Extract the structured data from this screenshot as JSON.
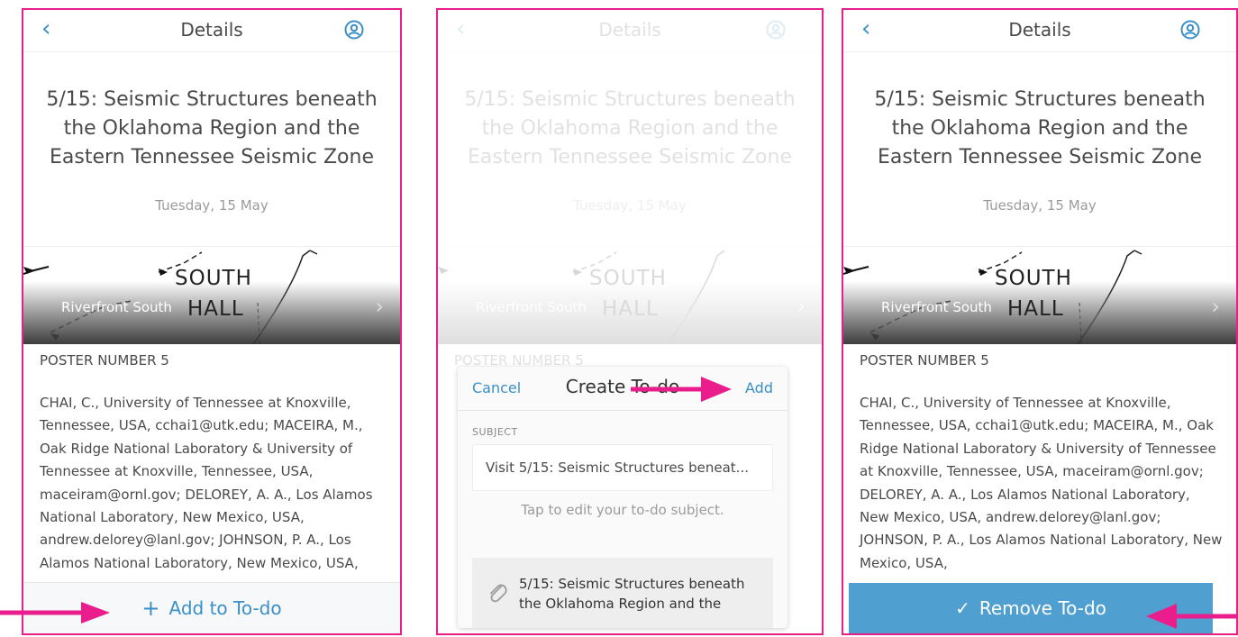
{
  "screens": [
    {
      "back_icon": "chevron-left-icon",
      "header_title": "Details",
      "profile_icon": "user-circle-icon",
      "event_title": "5/15: Seismic Structures beneath the Oklahoma Region and the Eastern Tennessee Seismic Zone",
      "event_date": "Tuesday, 15 May",
      "map_text_top": "SOUTH",
      "map_text_bottom": "HALL",
      "location": "Riverfront South",
      "poster_number": "POSTER NUMBER 5",
      "authors": "CHAI, C., University of Tennessee at Knoxville, Tennessee, USA, cchai1@utk.edu; MACEIRA, M., Oak Ridge National Laboratory & University of Tennessee at Knoxville, Tennessee, USA, maceiram@ornl.gov; DELOREY, A. A., Los Alamos National Laboratory, New Mexico, USA, andrew.delorey@lanl.gov; JOHNSON, P. A., Los Alamos National Laboratory, New Mexico, USA,",
      "footer_label": "Add to To-do",
      "footer_icon": "plus"
    },
    {
      "header_title": "Details",
      "event_title": "5/15: Seismic Structures beneath the Oklahoma Region and the Eastern Tennessee Seismic Zone",
      "event_date": "Tuesday, 15 May",
      "map_text_top": "SOUTH",
      "map_text_bottom": "HALL",
      "location": "Riverfront South",
      "poster_number": "POSTER NUMBER 5",
      "modal": {
        "cancel_label": "Cancel",
        "title": "Create To-do",
        "add_label": "Add",
        "subject_label": "SUBJECT",
        "subject_value": "Visit 5/15: Seismic Structures beneat...",
        "hint": "Tap to edit your to-do subject.",
        "attachment_icon": "paperclip-icon",
        "attachment_text": "5/15: Seismic Structures beneath the Oklahoma Region  and the"
      }
    },
    {
      "header_title": "Details",
      "event_title": "5/15: Seismic Structures beneath the Oklahoma Region and the Eastern Tennessee Seismic Zone",
      "event_date": "Tuesday, 15 May",
      "map_text_top": "SOUTH",
      "map_text_bottom": "HALL",
      "location": "Riverfront South",
      "poster_number": "POSTER NUMBER 5",
      "authors": "CHAI, C., University of Tennessee at Knoxville, Tennessee, USA, cchai1@utk.edu; MACEIRA, M., Oak Ridge National Laboratory & University of Tennessee at Knoxville, Tennessee, USA, maceiram@ornl.gov; DELOREY, A. A., Los Alamos National Laboratory, New Mexico, USA, andrew.delorey@lanl.gov; JOHNSON, P. A., Los Alamos National Laboratory, New Mexico, USA,",
      "footer_label": "Remove To-do",
      "footer_icon": "check"
    }
  ],
  "colors": {
    "accent": "#3b8fc7",
    "annotation": "#e91e8c",
    "remove_button": "#4f9fd1",
    "text": "#4a4a4a",
    "muted": "#9b9b9b"
  }
}
